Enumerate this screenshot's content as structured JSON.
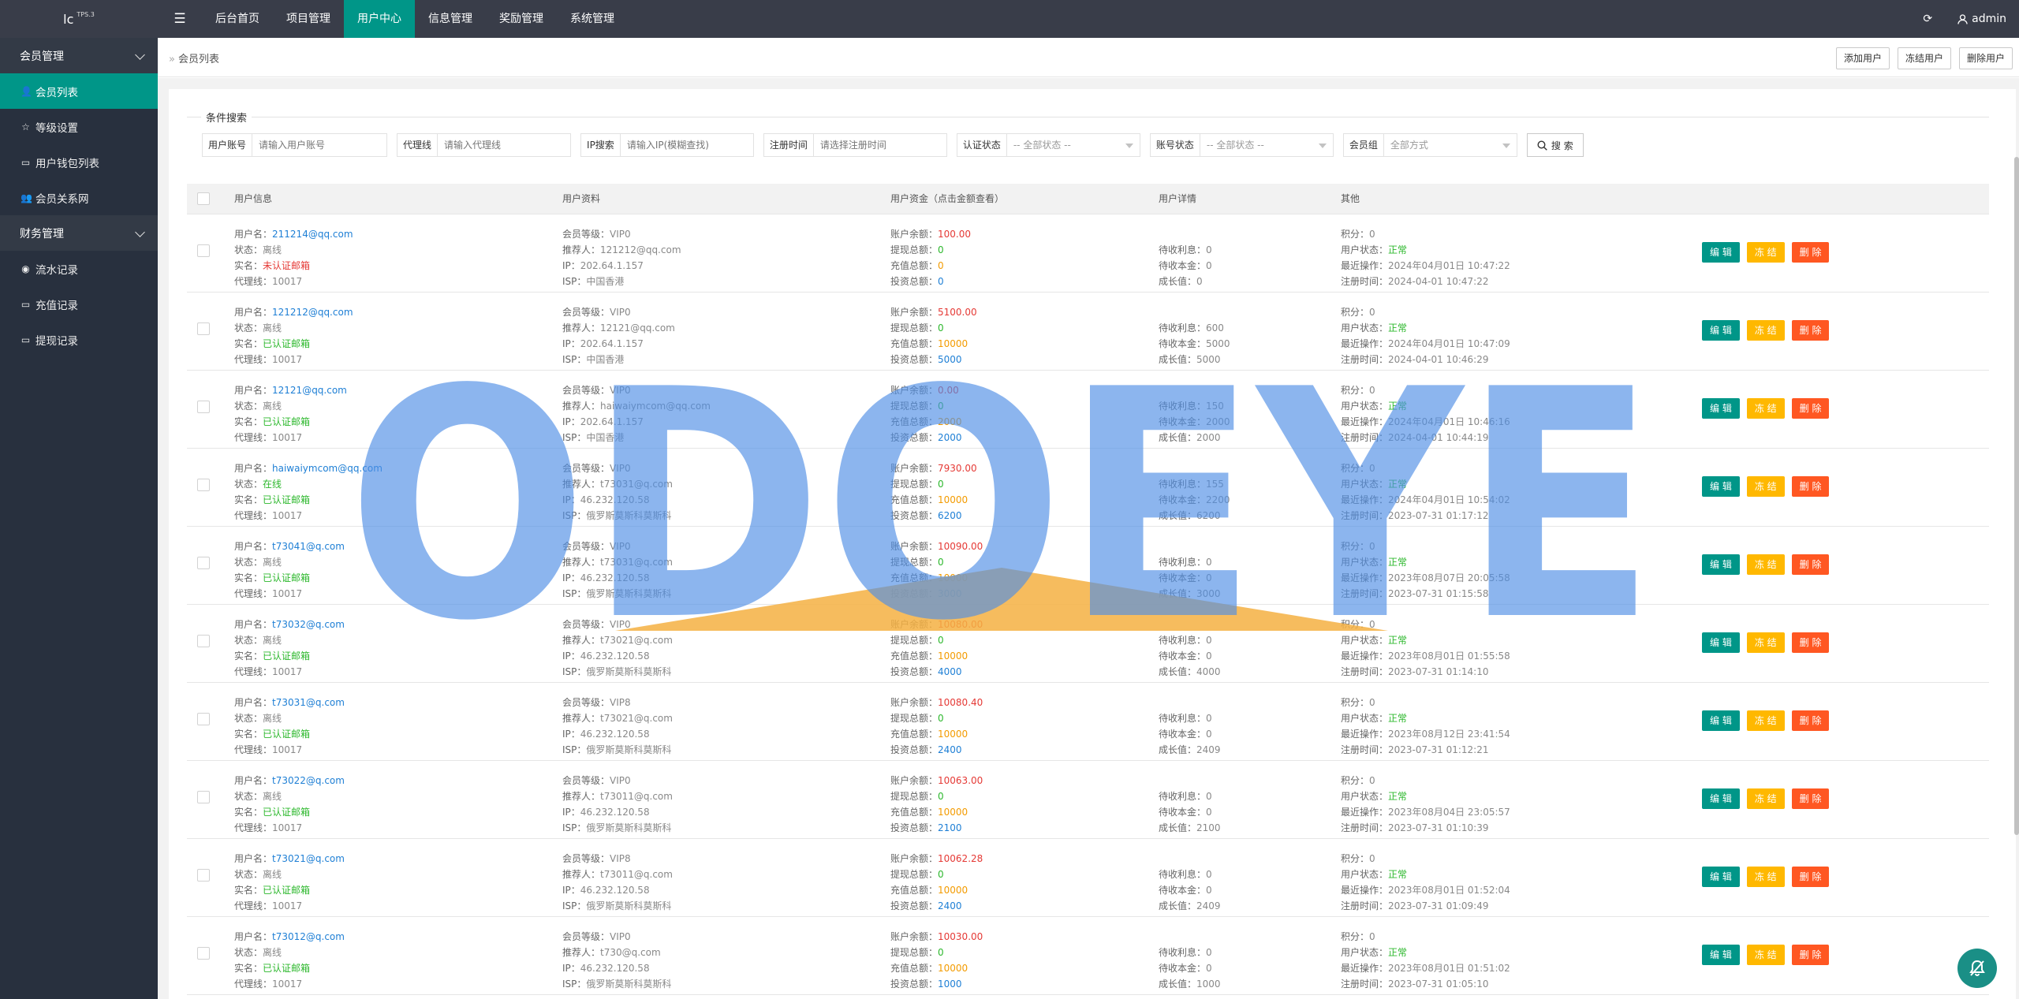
{
  "app": {
    "logo": "lc",
    "logo_sup": "TPS.3",
    "user": "admin"
  },
  "nav": [
    {
      "label": "后台首页"
    },
    {
      "label": "项目管理"
    },
    {
      "label": "用户中心",
      "active": true
    },
    {
      "label": "信息管理"
    },
    {
      "label": "奖励管理"
    },
    {
      "label": "系统管理"
    }
  ],
  "sidebar": {
    "groups": [
      {
        "label": "会员管理",
        "items": [
          {
            "label": "会员列表",
            "icon": "user-icon",
            "active": true
          },
          {
            "label": "等级设置",
            "icon": "star-icon"
          },
          {
            "label": "用户钱包列表",
            "icon": "card-icon"
          },
          {
            "label": "会员关系网",
            "icon": "users-icon"
          }
        ]
      },
      {
        "label": "财务管理",
        "items": [
          {
            "label": "流水记录",
            "icon": "circle-icon"
          },
          {
            "label": "充值记录",
            "icon": "card-icon"
          },
          {
            "label": "提现记录",
            "icon": "card-icon"
          }
        ]
      }
    ]
  },
  "breadcrumb": {
    "sep": "»",
    "label": "会员列表"
  },
  "subbar_buttons": [
    "添加用户",
    "冻结用户",
    "删除用户"
  ],
  "search": {
    "legend": "条件搜索",
    "filters": [
      {
        "label": "用户账号",
        "placeholder": "请输入用户账号",
        "type": "input",
        "w": 170
      },
      {
        "label": "代理线",
        "placeholder": "请输入代理线",
        "type": "input",
        "w": 168
      },
      {
        "label": "IP搜索",
        "placeholder": "请输入IP(模糊查找)",
        "type": "input",
        "w": 168
      },
      {
        "label": "注册时间",
        "placeholder": "请选择注册时间",
        "type": "input",
        "w": 168
      },
      {
        "label": "认证状态",
        "placeholder": "-- 全部状态 --",
        "type": "select",
        "w": 168
      },
      {
        "label": "账号状态",
        "placeholder": "-- 全部状态 --",
        "type": "select",
        "w": 168
      },
      {
        "label": "会员组",
        "placeholder": "全部方式",
        "type": "select",
        "w": 168
      }
    ],
    "button": "搜 索"
  },
  "table": {
    "headers": [
      "用户信息",
      "用户资料",
      "用户资金（点击金额查看）",
      "用户详情",
      "其他"
    ],
    "labels": {
      "username": "用户名：",
      "state": "状态：",
      "realname": "实名：",
      "agent": "代理线：",
      "level": "会员等级：",
      "referrer": "推荐人：",
      "ip": "IP：",
      "isp": "ISP：",
      "balance": "账户余额：",
      "withdraw": "提现总额：",
      "recharge": "充值总额：",
      "invest": "投资总额：",
      "pending_interest": "待收利息：",
      "pending_principal": "待收本金：",
      "growth": "成长值：",
      "points": "积分：",
      "ustate": "用户状态：",
      "last_op": "最近操作：",
      "reg_time": "注册时间："
    },
    "actions": {
      "edit": "编 辑",
      "freeze": "冻 结",
      "del": "删 除"
    },
    "rows": [
      {
        "username": "211214@qq.com",
        "state": "离线",
        "online": false,
        "realname": "未认证邮箱",
        "verified": false,
        "agent": "10017",
        "level": "VIP0",
        "referrer": "121212@qq.com",
        "ip": "202.64.1.157",
        "isp": "中国香港",
        "balance": "100.00",
        "withdraw": "0",
        "recharge": "0",
        "invest": "0",
        "pending_interest": "0",
        "pending_principal": "0",
        "growth": "0",
        "points": "0",
        "ustate": "正常",
        "last_op": "2024年04月01日 10:47:22",
        "reg_time": "2024-04-01 10:47:22"
      },
      {
        "username": "121212@qq.com",
        "state": "离线",
        "online": false,
        "realname": "已认证邮箱",
        "verified": true,
        "agent": "10017",
        "level": "VIP0",
        "referrer": "12121@qq.com",
        "ip": "202.64.1.157",
        "isp": "中国香港",
        "balance": "5100.00",
        "withdraw": "0",
        "recharge": "10000",
        "invest": "5000",
        "pending_interest": "600",
        "pending_principal": "5000",
        "growth": "5000",
        "points": "0",
        "ustate": "正常",
        "last_op": "2024年04月01日 10:47:09",
        "reg_time": "2024-04-01 10:46:29"
      },
      {
        "username": "12121@qq.com",
        "state": "离线",
        "online": false,
        "realname": "已认证邮箱",
        "verified": true,
        "agent": "10017",
        "level": "VIP0",
        "referrer": "haiwaiymcom@qq.com",
        "ip": "202.64.1.157",
        "isp": "中国香港",
        "balance": "0.00",
        "withdraw": "0",
        "recharge": "2000",
        "invest": "2000",
        "pending_interest": "150",
        "pending_principal": "2000",
        "growth": "2000",
        "points": "0",
        "ustate": "正常",
        "last_op": "2024年04月01日 10:46:16",
        "reg_time": "2024-04-01 10:44:19"
      },
      {
        "username": "haiwaiymcom@qq.com",
        "state": "在线",
        "online": true,
        "realname": "已认证邮箱",
        "verified": true,
        "agent": "10017",
        "level": "VIP0",
        "referrer": "t73031@q.com",
        "ip": "46.232.120.58",
        "isp": "俄罗斯莫斯科莫斯科",
        "balance": "7930.00",
        "withdraw": "0",
        "recharge": "10000",
        "invest": "6200",
        "pending_interest": "155",
        "pending_principal": "2200",
        "growth": "6200",
        "points": "0",
        "ustate": "正常",
        "last_op": "2024年04月01日 10:54:02",
        "reg_time": "2023-07-31 01:17:12"
      },
      {
        "username": "t73041@q.com",
        "state": "离线",
        "online": false,
        "realname": "已认证邮箱",
        "verified": true,
        "agent": "10017",
        "level": "VIP0",
        "referrer": "t73031@q.com",
        "ip": "46.232.120.58",
        "isp": "俄罗斯莫斯科莫斯科",
        "balance": "10090.00",
        "withdraw": "0",
        "recharge": "10000",
        "invest": "3000",
        "pending_interest": "0",
        "pending_principal": "0",
        "growth": "3000",
        "points": "0",
        "ustate": "正常",
        "last_op": "2023年08月07日 20:05:58",
        "reg_time": "2023-07-31 01:15:58"
      },
      {
        "username": "t73032@q.com",
        "state": "离线",
        "online": false,
        "realname": "已认证邮箱",
        "verified": true,
        "agent": "10017",
        "level": "VIP0",
        "referrer": "t73021@q.com",
        "ip": "46.232.120.58",
        "isp": "俄罗斯莫斯科莫斯科",
        "balance": "10080.00",
        "withdraw": "0",
        "recharge": "10000",
        "invest": "4000",
        "pending_interest": "0",
        "pending_principal": "0",
        "growth": "4000",
        "points": "0",
        "ustate": "正常",
        "last_op": "2023年08月01日 01:55:58",
        "reg_time": "2023-07-31 01:14:10"
      },
      {
        "username": "t73031@q.com",
        "state": "离线",
        "online": false,
        "realname": "已认证邮箱",
        "verified": true,
        "agent": "10017",
        "level": "VIP8",
        "referrer": "t73021@q.com",
        "ip": "46.232.120.58",
        "isp": "俄罗斯莫斯科莫斯科",
        "balance": "10080.40",
        "withdraw": "0",
        "recharge": "10000",
        "invest": "2400",
        "pending_interest": "0",
        "pending_principal": "0",
        "growth": "2409",
        "points": "0",
        "ustate": "正常",
        "last_op": "2023年08月12日 23:41:54",
        "reg_time": "2023-07-31 01:12:21"
      },
      {
        "username": "t73022@q.com",
        "state": "离线",
        "online": false,
        "realname": "已认证邮箱",
        "verified": true,
        "agent": "10017",
        "level": "VIP0",
        "referrer": "t73011@q.com",
        "ip": "46.232.120.58",
        "isp": "俄罗斯莫斯科莫斯科",
        "balance": "10063.00",
        "withdraw": "0",
        "recharge": "10000",
        "invest": "2100",
        "pending_interest": "0",
        "pending_principal": "0",
        "growth": "2100",
        "points": "0",
        "ustate": "正常",
        "last_op": "2023年08月04日 23:05:57",
        "reg_time": "2023-07-31 01:10:39"
      },
      {
        "username": "t73021@q.com",
        "state": "离线",
        "online": false,
        "realname": "已认证邮箱",
        "verified": true,
        "agent": "10017",
        "level": "VIP8",
        "referrer": "t73011@q.com",
        "ip": "46.232.120.58",
        "isp": "俄罗斯莫斯科莫斯科",
        "balance": "10062.28",
        "withdraw": "0",
        "recharge": "10000",
        "invest": "2400",
        "pending_interest": "0",
        "pending_principal": "0",
        "growth": "2409",
        "points": "0",
        "ustate": "正常",
        "last_op": "2023年08月01日 01:52:04",
        "reg_time": "2023-07-31 01:09:49"
      },
      {
        "username": "t73012@q.com",
        "state": "离线",
        "online": false,
        "realname": "已认证邮箱",
        "verified": true,
        "agent": "10017",
        "level": "VIP0",
        "referrer": "t730@q.com",
        "ip": "46.232.120.58",
        "isp": "俄罗斯莫斯科莫斯科",
        "balance": "10030.00",
        "withdraw": "0",
        "recharge": "10000",
        "invest": "1000",
        "pending_interest": "0",
        "pending_principal": "0",
        "growth": "1000",
        "points": "0",
        "ustate": "正常",
        "last_op": "2023年08月01日 01:51:02",
        "reg_time": "2023-07-31 01:05:10"
      }
    ]
  },
  "watermark": {
    "text": "ODOEYE",
    "color": "#4f8fe6",
    "accent": "#f5b042"
  },
  "colors": {
    "nav_bg": "#393d49",
    "sidebar_bg": "#28303e",
    "accent": "#009688",
    "freeze": "#ffb800",
    "delete": "#ff5722"
  }
}
